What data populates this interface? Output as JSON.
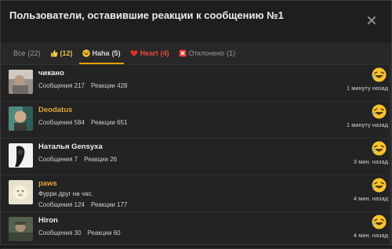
{
  "dialog": {
    "title": "Пользователи, оставившие реакции к сообщению №1"
  },
  "tabs": [
    {
      "label": "Все",
      "count": "(22)"
    },
    {
      "label": "",
      "count": "(12)"
    },
    {
      "label": "Haha",
      "count": "(5)"
    },
    {
      "label": "Heart",
      "count": "(4)"
    },
    {
      "label": "Отклонено",
      "count": "(1)"
    }
  ],
  "users": [
    {
      "name": "чикано",
      "note": "",
      "messages": "Сообщения 217",
      "reactions": "Реакции 428",
      "time": "1 минуту назад"
    },
    {
      "name": "Deodatus",
      "note": "",
      "messages": "Сообщения 584",
      "reactions": "Реакции 651",
      "time": "1 минуту назад"
    },
    {
      "name": "Наталья Gensyxa",
      "note": "",
      "messages": "Сообщения 7",
      "reactions": "Реакции 26",
      "time": "3 мин. назад"
    },
    {
      "name": "paws",
      "note": "Фурри друг на час.",
      "messages": "Сообщения 124",
      "reactions": "Реакции 177",
      "time": "4 мин. назад"
    },
    {
      "name": "Hiron",
      "note": "",
      "messages": "Сообщения 30",
      "reactions": "Реакции 60",
      "time": "4 мин. назад"
    }
  ],
  "icons": {
    "close": "close-icon",
    "like": "thumbs-up-icon",
    "haha": "laughing-emoji-icon",
    "heart": "heart-icon",
    "rejected": "rejected-icon"
  },
  "colors": {
    "accent": "#e4a100",
    "username_highlight": "#e2a43b",
    "heart": "#e84a3f",
    "background": "#232323"
  }
}
